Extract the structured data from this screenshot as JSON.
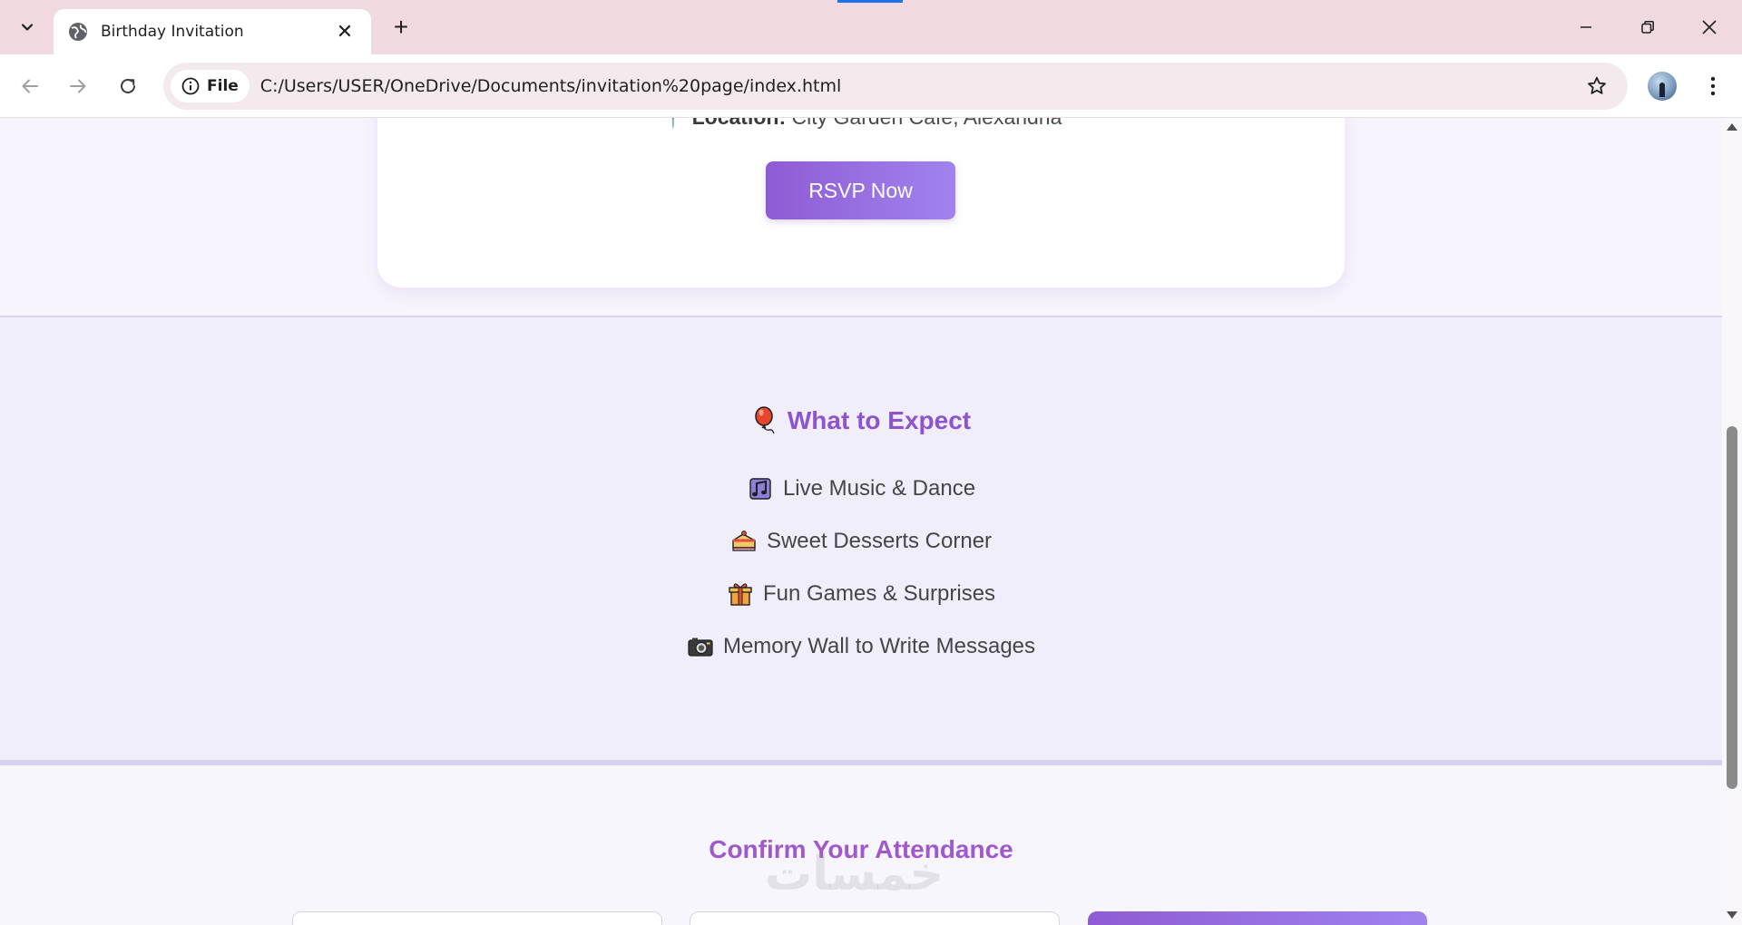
{
  "browser": {
    "tab_title": "Birthday Invitation",
    "new_tab_symbol": "+",
    "security_chip": "File",
    "url": "C:/Users/USER/OneDrive/Documents/invitation%20page/index.html"
  },
  "card": {
    "location_label": "Location:",
    "location_value": "City Garden Cafe, Alexandria",
    "rsvp_label": "RSVP Now"
  },
  "expect": {
    "title": "What to Expect",
    "items": [
      {
        "label": "Live Music & Dance",
        "icon": "music-notes-icon"
      },
      {
        "label": "Sweet Desserts Corner",
        "icon": "cake-slice-icon"
      },
      {
        "label": "Fun Games & Surprises",
        "icon": "gift-icon"
      },
      {
        "label": "Memory Wall to Write Messages",
        "icon": "camera-icon"
      }
    ]
  },
  "confirm": {
    "title": "Confirm Your Attendance",
    "watermark": "خمسات"
  },
  "colors": {
    "accent_purple": "#8e54d0",
    "button_gradient_start": "#8f5bd4",
    "button_gradient_end": "#a083ee",
    "titlebar": "#f1dadf"
  }
}
